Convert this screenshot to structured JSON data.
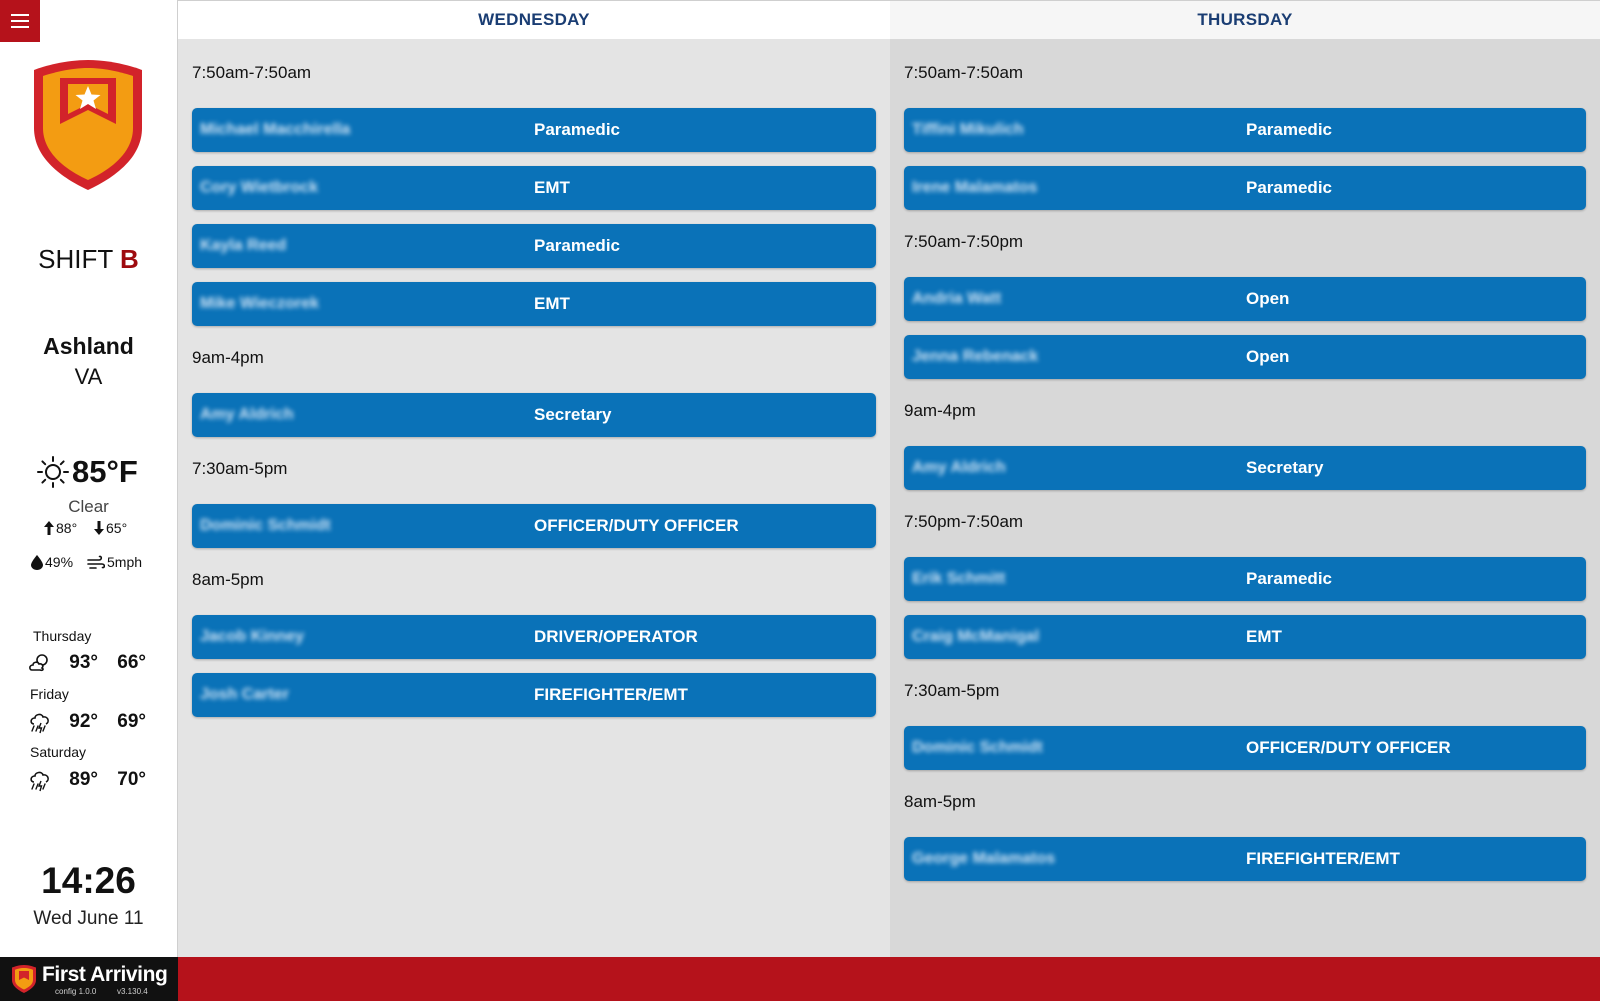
{
  "sidebar": {
    "shift_prefix": "SHIFT",
    "shift_letter": "B",
    "city": "Ashland",
    "state": "VA",
    "weather": {
      "current_temp": "85°F",
      "condition": "Clear",
      "icon": "sun-icon",
      "high": "88°",
      "low": "65°",
      "humidity": "49%",
      "wind": "5mph"
    },
    "forecast": [
      {
        "day": "Thursday",
        "icon": "partly-cloudy-icon",
        "high": "93°",
        "low": "66°"
      },
      {
        "day": "Friday",
        "icon": "thunderstorm-icon",
        "high": "92°",
        "low": "69°"
      },
      {
        "day": "Saturday",
        "icon": "thunderstorm-icon",
        "high": "89°",
        "low": "70°"
      }
    ],
    "clock": "14:26",
    "date": "Wed June 11"
  },
  "wednesday": {
    "header": "WEDNESDAY",
    "groups": [
      {
        "time": "7:50am-7:50am",
        "rows": [
          {
            "name": "Michael Macchirella",
            "role": "Paramedic"
          },
          {
            "name": "Cory Wietbrock",
            "role": "EMT"
          },
          {
            "name": "Kayla Reed",
            "role": "Paramedic"
          },
          {
            "name": "Mike Wieczorek",
            "role": "EMT"
          }
        ]
      },
      {
        "time": "9am-4pm",
        "rows": [
          {
            "name": "Amy Aldrich",
            "role": "Secretary"
          }
        ]
      },
      {
        "time": "7:30am-5pm",
        "rows": [
          {
            "name": "Dominic Schmidt",
            "role": "OFFICER/DUTY OFFICER"
          }
        ]
      },
      {
        "time": "8am-5pm",
        "rows": [
          {
            "name": "Jacob Kinney",
            "role": "DRIVER/OPERATOR"
          },
          {
            "name": "Josh Carter",
            "role": "FIREFIGHTER/EMT"
          }
        ]
      }
    ]
  },
  "thursday": {
    "header": "THURSDAY",
    "groups": [
      {
        "time": "7:50am-7:50am",
        "rows": [
          {
            "name": "Tiffini Mikulich",
            "role": "Paramedic"
          },
          {
            "name": "Irene Malamatos",
            "role": "Paramedic"
          }
        ]
      },
      {
        "time": "7:50am-7:50pm",
        "rows": [
          {
            "name": "Andria Watt",
            "role": "Open"
          },
          {
            "name": "Jenna Rebenack",
            "role": "Open"
          }
        ]
      },
      {
        "time": "9am-4pm",
        "rows": [
          {
            "name": "Amy Aldrich",
            "role": "Secretary"
          }
        ]
      },
      {
        "time": "7:50pm-7:50am",
        "rows": [
          {
            "name": "Erik Schmitt",
            "role": "Paramedic"
          },
          {
            "name": "Craig McManigal",
            "role": "EMT"
          }
        ]
      },
      {
        "time": "7:30am-5pm",
        "rows": [
          {
            "name": "Dominic Schmidt",
            "role": "OFFICER/DUTY OFFICER"
          }
        ]
      },
      {
        "time": "8am-5pm",
        "rows": [
          {
            "name": "George Malamatos",
            "role": "FIREFIGHTER/EMT"
          }
        ]
      }
    ]
  },
  "footer": {
    "brand": "First Arriving",
    "config": "config 1.0.0",
    "version": "v3.130.4"
  },
  "colors": {
    "brand_red": "#b5121b",
    "row_blue": "#0a72b8",
    "header_blue": "#1a3d73"
  }
}
